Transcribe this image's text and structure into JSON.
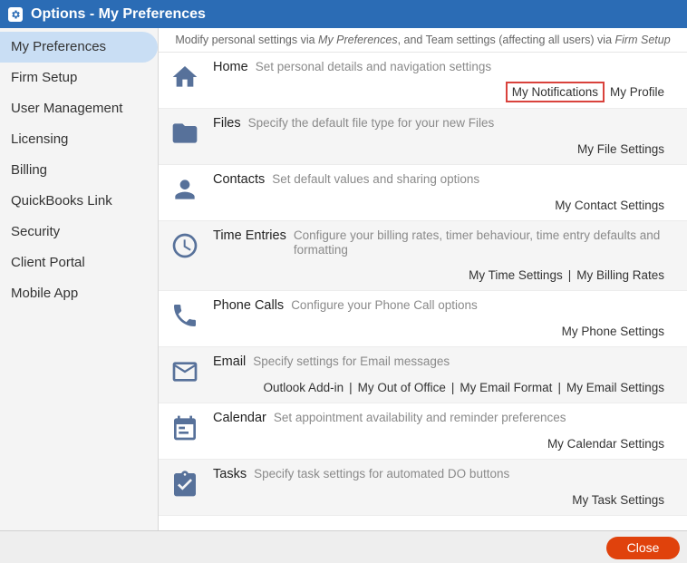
{
  "window": {
    "title": "Options - My Preferences",
    "icon": "gear-icon"
  },
  "sidebar": {
    "items": [
      {
        "label": "My Preferences",
        "active": true
      },
      {
        "label": "Firm Setup"
      },
      {
        "label": "User Management"
      },
      {
        "label": "Licensing"
      },
      {
        "label": "Billing"
      },
      {
        "label": "QuickBooks Link"
      },
      {
        "label": "Security"
      },
      {
        "label": "Client Portal"
      },
      {
        "label": "Mobile App"
      }
    ]
  },
  "intro": {
    "prefix": "Modify personal settings via ",
    "my_preferences": "My Preferences",
    "middle": ", and Team settings (affecting all users) via ",
    "firm_setup": "Firm Setup"
  },
  "sections": [
    {
      "icon": "home-icon",
      "name": "Home",
      "desc": "Set personal details and navigation settings",
      "links": [
        "My Notifications",
        "My Profile"
      ]
    },
    {
      "icon": "folder-icon",
      "name": "Files",
      "desc": "Specify the default file type for your new Files",
      "links": [
        "My File Settings"
      ]
    },
    {
      "icon": "person-icon",
      "name": "Contacts",
      "desc": "Set default values and sharing options",
      "links": [
        "My Contact Settings"
      ]
    },
    {
      "icon": "clock-icon",
      "name": "Time Entries",
      "desc": "Configure your billing rates, timer behaviour, time entry defaults and formatting",
      "links": [
        "My Time Settings",
        "My Billing Rates"
      ]
    },
    {
      "icon": "phone-icon",
      "name": "Phone Calls",
      "desc": "Configure your Phone Call options",
      "links": [
        "My Phone Settings"
      ]
    },
    {
      "icon": "envelope-icon",
      "name": "Email",
      "desc": "Specify settings for Email messages",
      "links": [
        "Outlook Add-in",
        "My Out of Office",
        "My Email Format",
        "My Email Settings"
      ]
    },
    {
      "icon": "calendar-icon",
      "name": "Calendar",
      "desc": "Set appointment availability and reminder preferences",
      "links": [
        "My Calendar Settings"
      ]
    },
    {
      "icon": "clipboard-check-icon",
      "name": "Tasks",
      "desc": "Specify task settings for automated DO buttons",
      "links": [
        "My Task Settings"
      ]
    }
  ],
  "footer": {
    "close_label": "Close",
    "close_color": "#e0420c"
  },
  "colors": {
    "titlebar": "#2b6cb5",
    "active_nav": "#c9def4",
    "icon": "#57719a",
    "highlight_box": "#d9423c"
  }
}
